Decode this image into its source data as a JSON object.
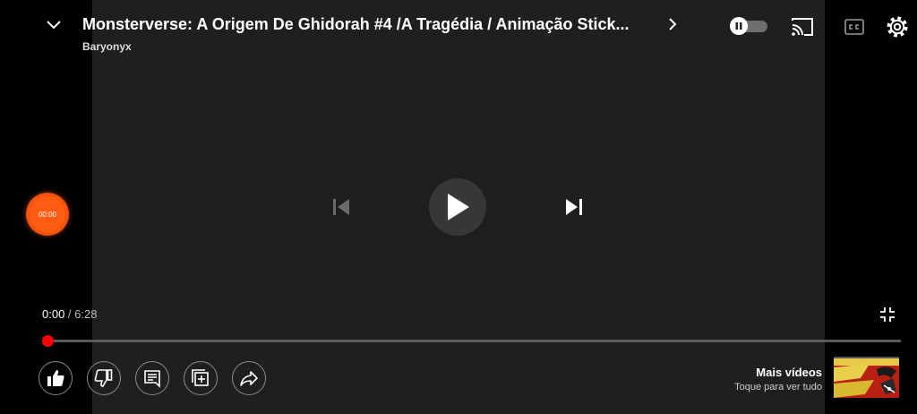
{
  "player": {
    "title": "Monsterverse: A Origem De Ghidorah #4 /A Tragédia / Animação Stick...",
    "channel": "Baryonyx",
    "time": {
      "current": "0:00",
      "separator": " / ",
      "duration": "6:28"
    },
    "progress": 0
  },
  "recorder": {
    "label": "00:00"
  },
  "more_videos": {
    "title": "Mais vídeos",
    "subtitle": "Toque para ver tudo"
  },
  "colors": {
    "accent": "#ff0000",
    "video_background": "#1f1f1f",
    "recorder": "#ff5a10"
  },
  "icons": {
    "top": [
      "chevron-down-icon",
      "chevron-right-icon",
      "pause-icon",
      "cast-icon",
      "cc-icon",
      "gear-icon"
    ],
    "center": [
      "previous-icon",
      "play-icon",
      "next-icon"
    ],
    "bottom": [
      "exit-fullscreen-icon",
      "like-icon",
      "dislike-icon",
      "comments-icon",
      "save-playlist-icon",
      "share-icon"
    ]
  }
}
